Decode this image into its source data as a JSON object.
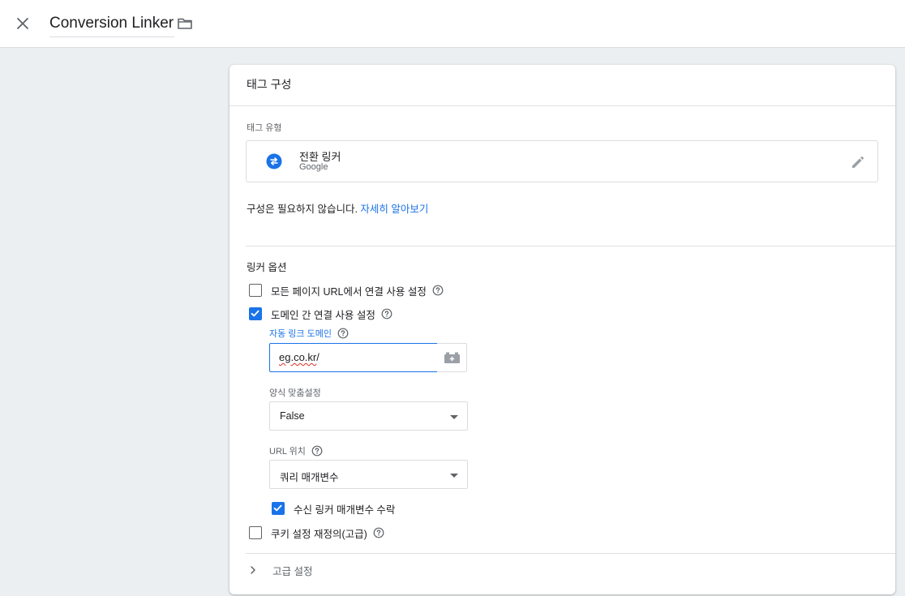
{
  "header": {
    "close_icon": "close-icon",
    "title": "Conversion Linker",
    "folder_icon": "folder-icon"
  },
  "card": {
    "title": "태그 구성",
    "tag_type_label": "태그 유형",
    "tag_type": {
      "name": "전환 링커",
      "vendor": "Google",
      "icon": "conversion-linker-icon",
      "edit_icon": "pencil-icon"
    },
    "info_text": "구성은 필요하지 않습니다. ",
    "learn_more": "자세히 알아보기",
    "linker_options_title": "링커 옵션",
    "options": {
      "all_pages_url": {
        "label": "모든 페이지 URL에서 연결 사용 설정",
        "checked": false
      },
      "cross_domain": {
        "label": "도메인 간 연결 사용 설정",
        "checked": true
      },
      "accept_incoming": {
        "label": "수신 링커 매개변수 수락",
        "checked": true
      },
      "cookie_override": {
        "label": "쿠키 설정 재정의(고급)",
        "checked": false
      }
    },
    "auto_link_domains": {
      "label": "자동 링크 도메인",
      "value_underlined": "eg.co.kr",
      "value_rest": "/"
    },
    "decorate_forms": {
      "label": "양식 맞춤설정",
      "selected": "False"
    },
    "url_position": {
      "label": "URL 위치",
      "selected": "쿼리 매개변수"
    },
    "advanced_settings": "고급 설정"
  },
  "colors": {
    "accent": "#1a73e8",
    "background": "#eceff1"
  }
}
